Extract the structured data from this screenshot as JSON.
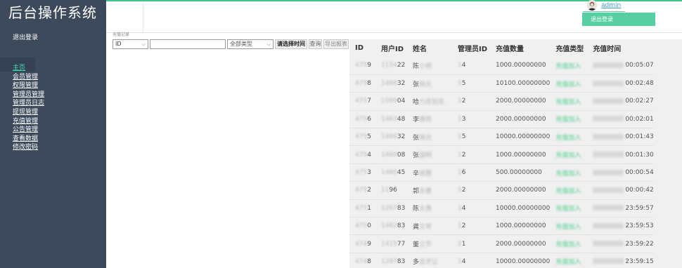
{
  "brand": {
    "title": "后台操作系统"
  },
  "sidebar": {
    "logout_label": "退出登录",
    "items": [
      {
        "label": "主页",
        "active": true
      },
      {
        "label": "会员管理"
      },
      {
        "label": "权限管理"
      },
      {
        "label": "管理员管理"
      },
      {
        "label": "管理员日志"
      },
      {
        "label": "提现管理"
      },
      {
        "label": "充值管理"
      },
      {
        "label": "公告管理"
      },
      {
        "label": "查看数据"
      },
      {
        "label": "修改密码"
      }
    ]
  },
  "header": {
    "username": "admin",
    "logout_button": "退出登录"
  },
  "filter": {
    "caption": "充值记录",
    "field_select": "ID",
    "search_value": "",
    "type_select": "全部类型",
    "time_button": "请选择时间",
    "query_button": "查询",
    "export_button": "导出报表"
  },
  "table": {
    "columns": [
      "ID",
      "用户ID",
      "姓名",
      "管理员ID",
      "充值数量",
      "充值类型",
      "充值时间"
    ],
    "rows": [
      {
        "id_prefix": "475",
        "id_suffix": "9",
        "uid_prefix": "1154",
        "uid_suffix": "22",
        "name_first": "陈",
        "name_rest": "小明",
        "admin_prefix": "1",
        "admin_suffix": "4",
        "amount": "1000.00000000",
        "type": "充值加入",
        "time_date": "2021-04-19",
        "time": "00:05:07"
      },
      {
        "id_prefix": "475",
        "id_suffix": "8",
        "uid_prefix": "1466",
        "uid_suffix": "32",
        "name_first": "张",
        "name_rest": "晓光",
        "admin_prefix": "1",
        "admin_suffix": "5",
        "amount": "10100.00000000",
        "type": "充值加入",
        "time_date": "2021-04-19",
        "time": "00:02:48"
      },
      {
        "id_prefix": "475",
        "id_suffix": "7",
        "uid_prefix": "1099",
        "uid_suffix": "04",
        "name_first": "哈",
        "name_rest": "力克别克",
        "admin_prefix": "1",
        "admin_suffix": "2",
        "amount": "2000.00000000",
        "type": "充值加入",
        "time_date": "2021-04-19",
        "time": "00:02:27"
      },
      {
        "id_prefix": "475",
        "id_suffix": "6",
        "uid_prefix": "1463",
        "uid_suffix": "48",
        "name_first": "李",
        "name_rest": "德亮",
        "admin_prefix": "1",
        "admin_suffix": "3",
        "amount": "2000.00000000",
        "type": "充值加入",
        "time_date": "2021-04-19",
        "time": "00:02:01"
      },
      {
        "id_prefix": "475",
        "id_suffix": "5",
        "uid_prefix": "1466",
        "uid_suffix": "32",
        "name_first": "张",
        "name_rest": "晓光",
        "admin_prefix": "1",
        "admin_suffix": "5",
        "amount": "10000.00000000",
        "type": "充值加入",
        "time_date": "2021-04-19",
        "time": "00:01:43"
      },
      {
        "id_prefix": "475",
        "id_suffix": "4",
        "uid_prefix": "1460",
        "uid_suffix": "08",
        "name_first": "张",
        "name_rest": "国明",
        "admin_prefix": "1",
        "admin_suffix": "2",
        "amount": "1000.00000000",
        "type": "充值加入",
        "time_date": "2021-04-19",
        "time": "00:01:30"
      },
      {
        "id_prefix": "475",
        "id_suffix": "3",
        "uid_prefix": "1460",
        "uid_suffix": "45",
        "name_first": "辛",
        "name_rest": "丽茜",
        "admin_prefix": "1",
        "admin_suffix": "6",
        "amount": "500.00000000",
        "type": "充值加入",
        "time_date": "2021-04-19",
        "time": "00:00:54"
      },
      {
        "id_prefix": "475",
        "id_suffix": "2",
        "uid_prefix": "11",
        "uid_suffix": "96",
        "name_first": "郭",
        "name_rest": "永惠",
        "admin_prefix": "1",
        "admin_suffix": "2",
        "amount": "2000.00000000",
        "type": "充值加入",
        "time_date": "2021-04-19",
        "time": "00:00:42"
      },
      {
        "id_prefix": "475",
        "id_suffix": "1",
        "uid_prefix": "1267",
        "uid_suffix": "83",
        "name_first": "陈",
        "name_rest": "太勇",
        "admin_prefix": "1",
        "admin_suffix": "4",
        "amount": "10000.00000000",
        "type": "充值加入",
        "time_date": "2021-04-18",
        "time": "23:59:57"
      },
      {
        "id_prefix": "475",
        "id_suffix": "0",
        "uid_prefix": "1462",
        "uid_suffix": "83",
        "name_first": "龚",
        "name_rest": "文琴",
        "admin_prefix": "1",
        "admin_suffix": "2",
        "amount": "1000.00000000",
        "type": "充值加入",
        "time_date": "2021-04-18",
        "time": "23:59:53"
      },
      {
        "id_prefix": "474",
        "id_suffix": "9",
        "uid_prefix": "1415",
        "uid_suffix": "77",
        "name_first": "董",
        "name_rest": "立华",
        "admin_prefix": "2",
        "admin_suffix": "1",
        "amount": "2000.00000000",
        "type": "充值加入",
        "time_date": "2021-04-18",
        "time": "23:59:22"
      },
      {
        "id_prefix": "474",
        "id_suffix": "8",
        "uid_prefix": "1297",
        "uid_suffix": "83",
        "name_first": "多",
        "name_rest": "吉才让",
        "admin_prefix": "1",
        "admin_suffix": "4",
        "amount": "10000.00000000",
        "type": "充值加入",
        "time_date": "2021-04-18",
        "time": "23:59:15"
      }
    ]
  }
}
